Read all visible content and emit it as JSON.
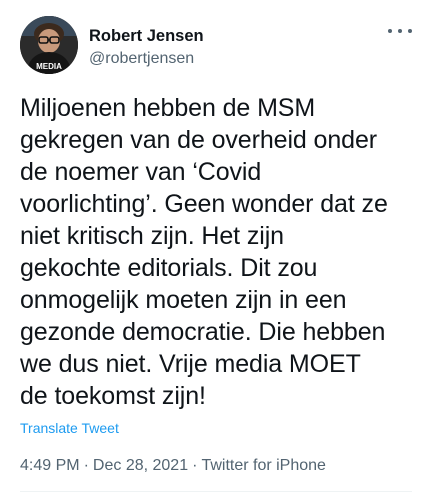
{
  "tweet": {
    "author": {
      "display_name": "Robert Jensen",
      "handle": "@robertjensen",
      "avatar_text": "MEDIA"
    },
    "more_icon": "ellipsis-icon",
    "text": "Miljoenen hebben de MSM\ngekregen van de overheid onder\nde noemer van ‘Covid\nvoorlichting’. Geen wonder dat ze\nniet kritisch zijn. Het zijn\ngekochte editorials. Dit zou\nonmogelijk moeten zijn in een\ngezonde democratie. Die hebben\nwe dus niet. Vrije media MOET\nde toekomst zijn!",
    "translate_label": "Translate Tweet",
    "time": "4:49 PM",
    "date": "Dec 28, 2021",
    "source": "Twitter for iPhone",
    "separator": "·"
  },
  "colors": {
    "text": "#0f1419",
    "secondary": "#536471",
    "link": "#1d9bf0"
  }
}
